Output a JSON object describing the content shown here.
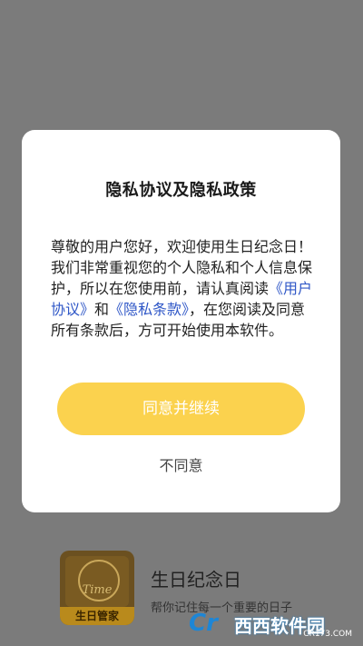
{
  "background_app": {
    "icon_text": "Time",
    "icon_label": "生日管家",
    "title": "生日纪念日",
    "subtitle": "帮你记住每一个重要的日子"
  },
  "modal": {
    "title": "隐私协议及隐私政策",
    "body_part1": "尊敬的用户您好，欢迎使用生日纪念日！我们非常重视您的个人隐私和个人信息保护，所以在您使用前，请认真阅读",
    "link_user_agreement": "《用户协议》",
    "body_and": "和",
    "link_privacy": "《隐私条款》",
    "body_part2": "，在您阅读及同意所有条款后，方可开始使用本软件。",
    "agree_label": "同意并继续",
    "disagree_label": "不同意"
  },
  "watermark": {
    "logo": "Cr",
    "text": "西西软件园",
    "url": "CR173.COM"
  },
  "colors": {
    "overlay": "#7b7b7b",
    "button": "#fbd24e",
    "link": "#2f57c7"
  }
}
